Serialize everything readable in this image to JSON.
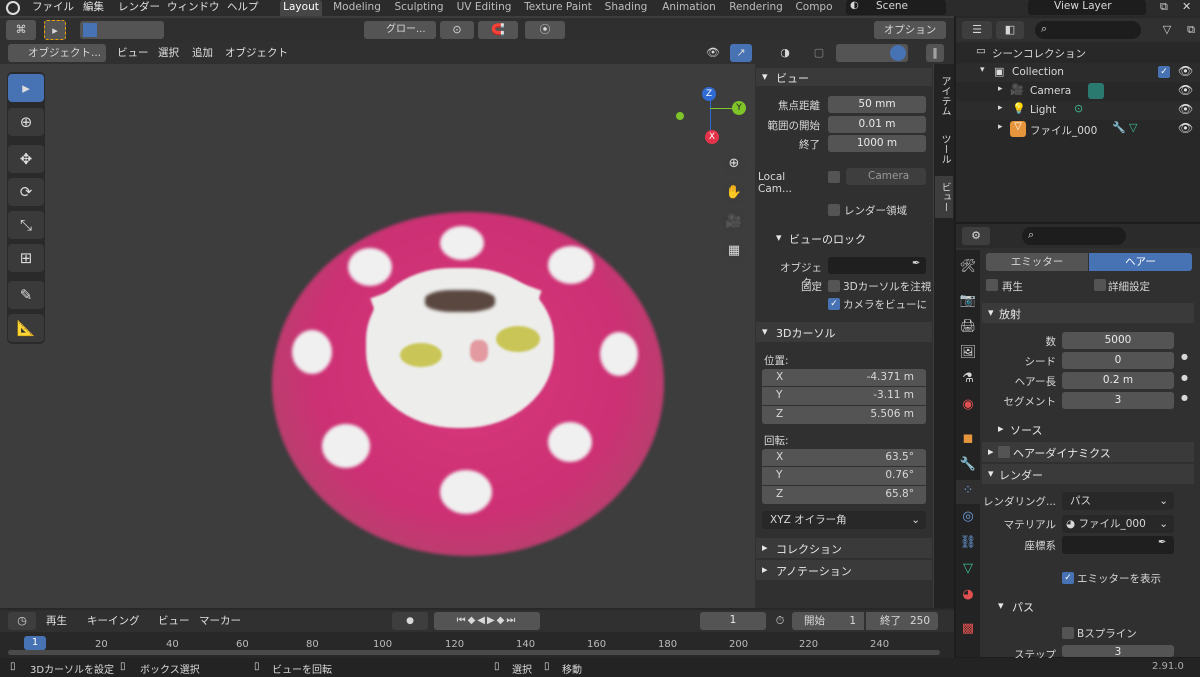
{
  "topbar": {
    "menus": [
      "ファイル",
      "編集",
      "レンダー",
      "ウィンドウ",
      "ヘルプ"
    ],
    "tabs": [
      "Layout",
      "Modeling",
      "Sculpting",
      "UV Editing",
      "Texture Paint",
      "Shading",
      "Animation",
      "Rendering",
      "Compo"
    ],
    "scene": "Scene",
    "view_layer": "View Layer"
  },
  "viewport": {
    "mode": "オブジェクト...",
    "menus": [
      "ビュー",
      "選択",
      "追加",
      "オブジェクト"
    ],
    "orientation": "グロー...",
    "options": "オプション"
  },
  "npanel": {
    "tabs": [
      "アイテム",
      "ツール",
      "ビュー"
    ],
    "view_title": "ビュー",
    "focal_label": "焦点距離",
    "focal": "50 mm",
    "clip_start_label": "範囲の開始",
    "clip_start": "0.01 m",
    "clip_end_label": "終了",
    "clip_end": "1000 m",
    "local_cam_label": "Local Cam...",
    "local_cam_value": "Camera",
    "render_region": "レンダー領域",
    "view_lock": "ビューのロック",
    "lock_object_label": "オブジェク...",
    "lock_label": "固定",
    "lock_cursor": "3Dカーソルを注視",
    "lock_camera": "カメラをビューに",
    "cursor_title": "3Dカーソル",
    "location_label": "位置:",
    "loc_x": "-4.371 m",
    "loc_y": "-3.11 m",
    "loc_z": "5.506 m",
    "rotation_label": "回転:",
    "rot_x": "63.5°",
    "rot_y": "0.76°",
    "rot_z": "65.8°",
    "rot_mode": "XYZ オイラー角",
    "collection": "コレクション",
    "annotation": "アノテーション",
    "axes": {
      "x": "X",
      "y": "Y",
      "z": "Z"
    }
  },
  "outliner": {
    "scene_collection": "シーンコレクション",
    "items": [
      "Collection",
      "Camera",
      "Light",
      "ファイル_000"
    ]
  },
  "properties": {
    "emitter": "エミッター",
    "hair": "ヘアー",
    "regrow": "再生",
    "advanced": "詳細設定",
    "emission": "放射",
    "number_label": "数",
    "number": "5000",
    "seed_label": "シード",
    "seed": "0",
    "hair_length_label": "ヘアー長",
    "hair_length": "0.2 m",
    "segments_label": "セグメント",
    "segments": "3",
    "source": "ソース",
    "hair_dynamics": "ヘアーダイナミクス",
    "render": "レンダー",
    "render_as_label": "レンダリング...",
    "render_as": "パス",
    "material_label": "マテリアル",
    "material": "ファイル_000",
    "coordinate_label": "座標系",
    "show_emitter": "エミッターを表示",
    "path": "パス",
    "bspline": "Bスプライン",
    "steps_label": "ステップ",
    "steps": "3"
  },
  "timeline": {
    "menus": [
      "再生",
      "キーイング",
      "ビュー",
      "マーカー"
    ],
    "current_frame": "1",
    "start_label": "開始",
    "start": "1",
    "end_label": "終了",
    "end": "250",
    "ticks": [
      "1",
      "20",
      "40",
      "60",
      "80",
      "100",
      "120",
      "140",
      "160",
      "180",
      "200",
      "220",
      "240"
    ]
  },
  "statusbar": {
    "items": [
      "3Dカーソルを設定",
      "ボックス選択",
      "ビューを回転",
      "選択",
      "移動"
    ],
    "version": "2.91.0"
  }
}
